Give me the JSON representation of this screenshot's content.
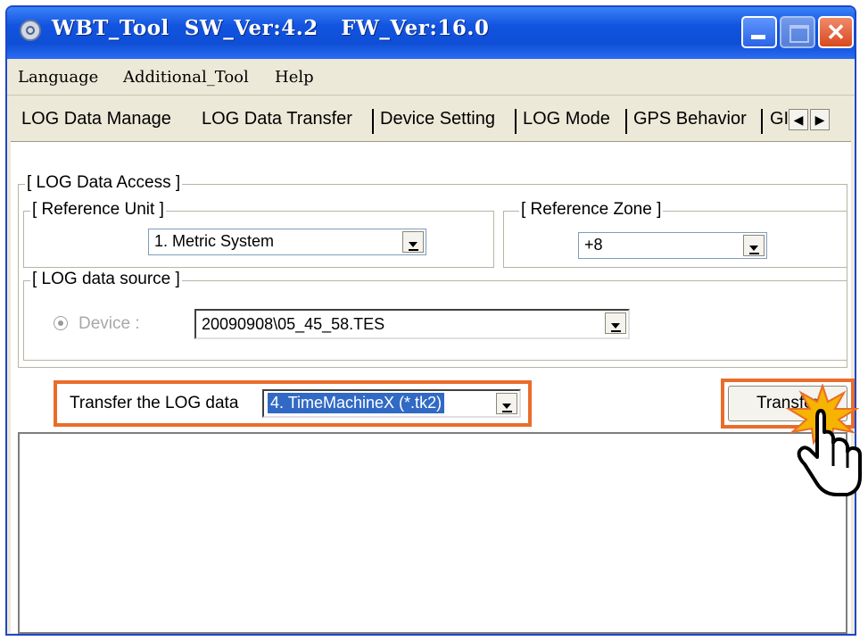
{
  "window": {
    "title": "WBT_Tool  SW_Ver:4.2   FW_Ver:16.0"
  },
  "menu": [
    "Language",
    "Additional_Tool",
    "Help"
  ],
  "tabs": [
    {
      "label": "LOG Data Manage",
      "active": false
    },
    {
      "label": "LOG Data Transfer",
      "active": true
    },
    {
      "label": "Device Setting",
      "active": false
    },
    {
      "label": "LOG Mode",
      "active": false
    },
    {
      "label": "GPS Behavior",
      "active": false
    },
    {
      "label": "GI",
      "active": false
    }
  ],
  "tab_scroll": {
    "left": "◀",
    "right": "▶"
  },
  "log_data_access": {
    "label": "[ LOG Data Access ]",
    "reference_unit": {
      "label": "[ Reference Unit ]",
      "value": "1. Metric System"
    },
    "reference_zone": {
      "label": "[ Reference Zone ]",
      "value": "+8"
    },
    "log_data_source": {
      "label": "[ LOG data source ]",
      "device_label": "Device :",
      "device_value": "20090908\\05_45_58.TES"
    }
  },
  "transfer": {
    "label": "Transfer the LOG data",
    "format_value": "4. TimeMachineX (*.tk2)",
    "button_label": "Transfer"
  },
  "colors": {
    "highlight": "#e96d2a",
    "titlebar": "#0f4fd6",
    "selection": "#316ac5"
  }
}
